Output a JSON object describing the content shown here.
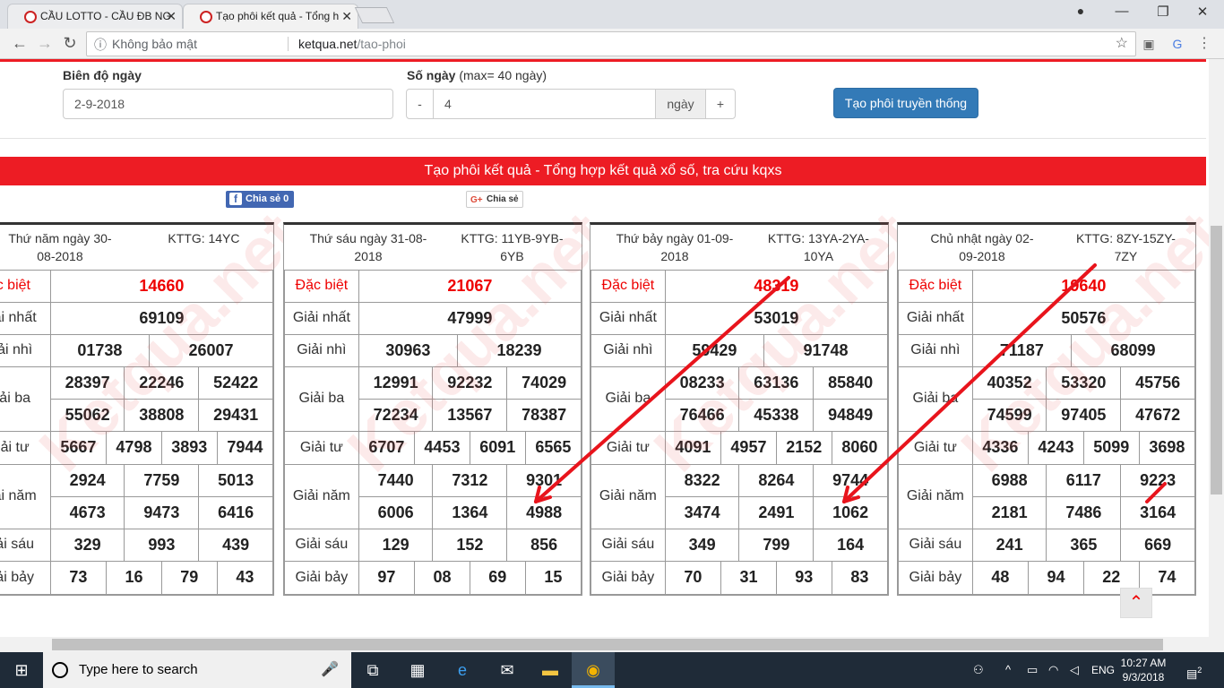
{
  "browser": {
    "tabs": [
      {
        "title": "CẦU LOTTO - CẦU ĐB NG"
      },
      {
        "title": "Tạo phôi kết quả - Tổng h"
      }
    ],
    "url_security": "Không bảo mật",
    "url_host": "ketqua.net",
    "url_path": "/tao-phoi"
  },
  "form": {
    "bien_do_label": "Biên độ ngày",
    "bien_do_value": "2-9-2018",
    "so_ngay_label": "Số ngày",
    "so_ngay_hint": "(max= 40 ngày)",
    "minus": "-",
    "so_ngay_value": "4",
    "ngay_unit": "ngày",
    "plus": "+",
    "submit": "Tạo phôi truyền thống"
  },
  "banner": "Tạo phôi kết quả - Tổng hợp kết quả xổ số, tra cứu kqxs",
  "share": {
    "fb": "Chia sẻ 0",
    "gplus": "Chia sẻ"
  },
  "watermark": "Ketqua.net",
  "prize_names": [
    "Đặc biệt",
    "Giải nhất",
    "Giải nhì",
    "Giải ba",
    "Giải tư",
    "Giải năm",
    "Giải sáu",
    "Giải bảy"
  ],
  "prize_names_cut": [
    "c biệt",
    "iải nhất",
    "iải nhì",
    "iải ba",
    "iải tư",
    "iải năm",
    "iải sáu",
    "iải bảy"
  ],
  "results": [
    {
      "date1": "Thứ năm ngày 30-",
      "date2": "08-2018",
      "kttg1": "KTTG: 14YC",
      "kttg2": "",
      "db": "14660",
      "g1": "69109",
      "g2": [
        "01738",
        "26007"
      ],
      "g3": [
        "28397",
        "22246",
        "52422",
        "55062",
        "38808",
        "29431"
      ],
      "g4": [
        "5667",
        "4798",
        "3893",
        "7944"
      ],
      "g5": [
        "2924",
        "7759",
        "5013",
        "4673",
        "9473",
        "6416"
      ],
      "g6": [
        "329",
        "993",
        "439"
      ],
      "g7": [
        "73",
        "16",
        "79",
        "43"
      ]
    },
    {
      "date1": "Thứ sáu ngày 31-08-",
      "date2": "2018",
      "kttg1": "KTTG: 11YB-9YB-",
      "kttg2": "6YB",
      "db": "21067",
      "g1": "47999",
      "g2": [
        "30963",
        "18239"
      ],
      "g3": [
        "12991",
        "92232",
        "74029",
        "72234",
        "13567",
        "78387"
      ],
      "g4": [
        "6707",
        "4453",
        "6091",
        "6565"
      ],
      "g5": [
        "7440",
        "7312",
        "9301",
        "6006",
        "1364",
        "4988"
      ],
      "g6": [
        "129",
        "152",
        "856"
      ],
      "g7": [
        "97",
        "08",
        "69",
        "15"
      ]
    },
    {
      "date1": "Thứ bảy ngày 01-09-",
      "date2": "2018",
      "kttg1": "KTTG: 13YA-2YA-",
      "kttg2": "10YA",
      "db": "48319",
      "g1": "53019",
      "g2": [
        "59429",
        "91748"
      ],
      "g3": [
        "08233",
        "63136",
        "85840",
        "76466",
        "45338",
        "94849"
      ],
      "g4": [
        "4091",
        "4957",
        "2152",
        "8060"
      ],
      "g5": [
        "8322",
        "8264",
        "9744",
        "3474",
        "2491",
        "1062"
      ],
      "g6": [
        "349",
        "799",
        "164"
      ],
      "g7": [
        "70",
        "31",
        "93",
        "83"
      ]
    },
    {
      "date1": "Chủ nhật ngày 02-",
      "date2": "09-2018",
      "kttg1": "KTTG: 8ZY-15ZY-",
      "kttg2": "7ZY",
      "db": "19640",
      "g1": "50576",
      "g2": [
        "71187",
        "68099"
      ],
      "g3": [
        "40352",
        "53320",
        "45756",
        "74599",
        "97405",
        "47672"
      ],
      "g4": [
        "4336",
        "4243",
        "5099",
        "3698"
      ],
      "g5": [
        "6988",
        "6117",
        "9223",
        "2181",
        "7486",
        "3164"
      ],
      "g6": [
        "241",
        "365",
        "669"
      ],
      "g7": [
        "48",
        "94",
        "22",
        "74"
      ]
    }
  ],
  "taskbar": {
    "search_placeholder": "Type here to search",
    "lang": "ENG",
    "time": "10:27 AM",
    "date": "9/3/2018",
    "notif_count": "2"
  },
  "colors": {
    "accent_red": "#ed1c24",
    "button_blue": "#337ab7",
    "arrow_red": "#e8141c"
  }
}
